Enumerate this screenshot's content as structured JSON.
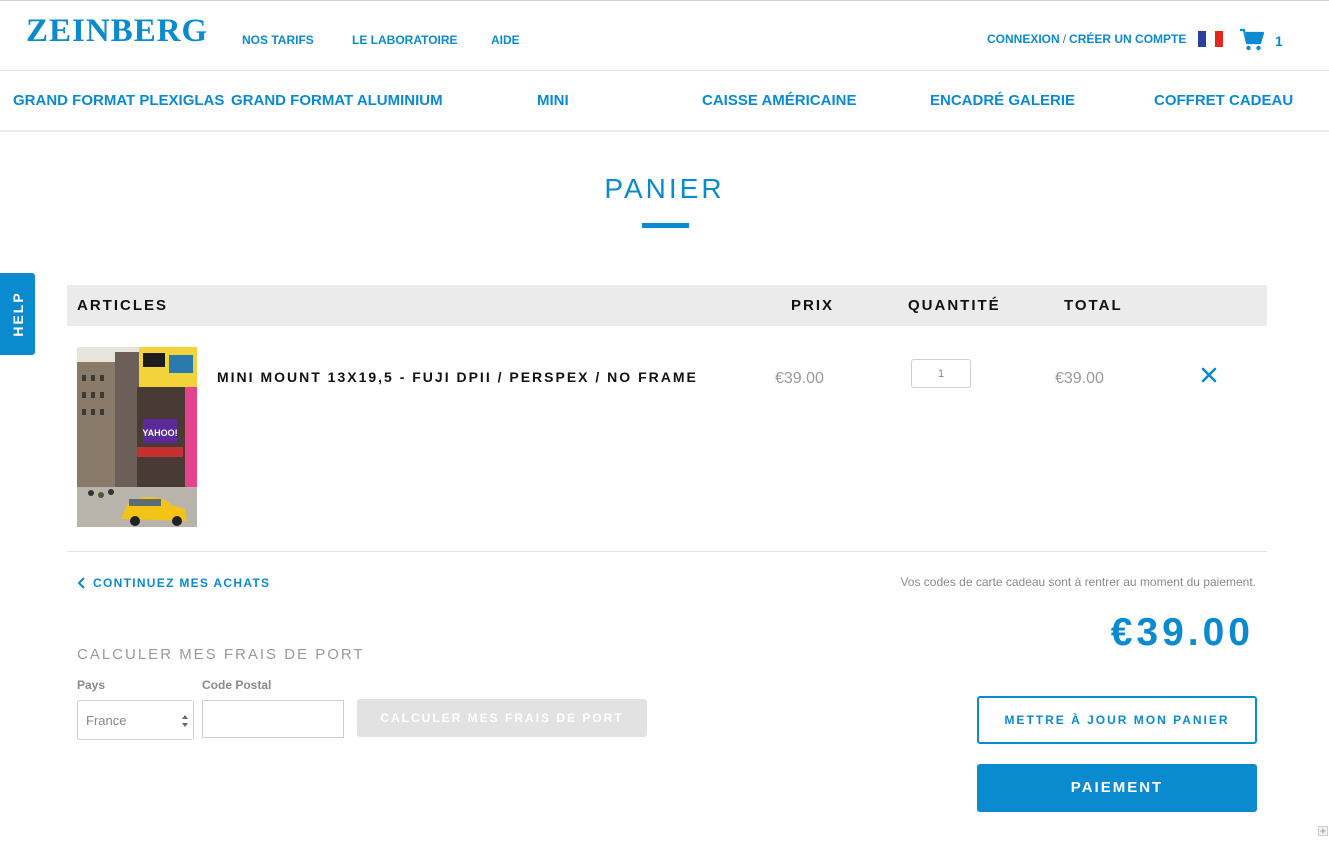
{
  "header": {
    "logo": "ZEINBERG",
    "nav": [
      "NOS TARIFS",
      "LE LABORATOIRE",
      "AIDE"
    ],
    "login_label": "CONNEXION",
    "separator": "/",
    "create_account_label": "CRÉER UN COMPTE",
    "cart_count": "1"
  },
  "categories": [
    "GRAND FORMAT PLEXIGLAS",
    "GRAND FORMAT ALUMINIUM",
    "MINI",
    "CAISSE AMÉRICAINE",
    "ENCADRÉ GALERIE",
    "COFFRET CADEAU"
  ],
  "help_tab": "HELP",
  "page": {
    "title": "PANIER"
  },
  "table": {
    "headers": {
      "articles": "ARTICLES",
      "price": "PRIX",
      "quantity": "QUANTITÉ",
      "total": "TOTAL"
    },
    "items": [
      {
        "name": "MINI MOUNT 13X19,5 - FUJI DPII / PERSPEX / NO FRAME",
        "price": "€39.00",
        "quantity": "1",
        "total": "€39.00"
      }
    ]
  },
  "continue_label": "CONTINUEZ MES ACHATS",
  "shipping": {
    "title": "CALCULER MES FRAIS DE PORT",
    "country_label": "Pays",
    "country_value": "France",
    "postal_label": "Code Postal",
    "postal_value": "",
    "calc_button": "CALCULER MES FRAIS DE PORT"
  },
  "summary": {
    "gift_note": "Vos codes de carte cadeau sont à rentrer au moment du paiement.",
    "total": "€39.00",
    "update_button": "METTRE À JOUR MON PANIER",
    "pay_button": "PAIEMENT"
  },
  "colors": {
    "accent": "#0a8bd0",
    "header_bg": "#ebebeb",
    "muted": "#9a9a9a"
  },
  "icons": [
    "cart-icon",
    "flag-fr-icon",
    "close-icon",
    "chevron-left-icon",
    "select-arrows-icon",
    "plus-icon"
  ]
}
